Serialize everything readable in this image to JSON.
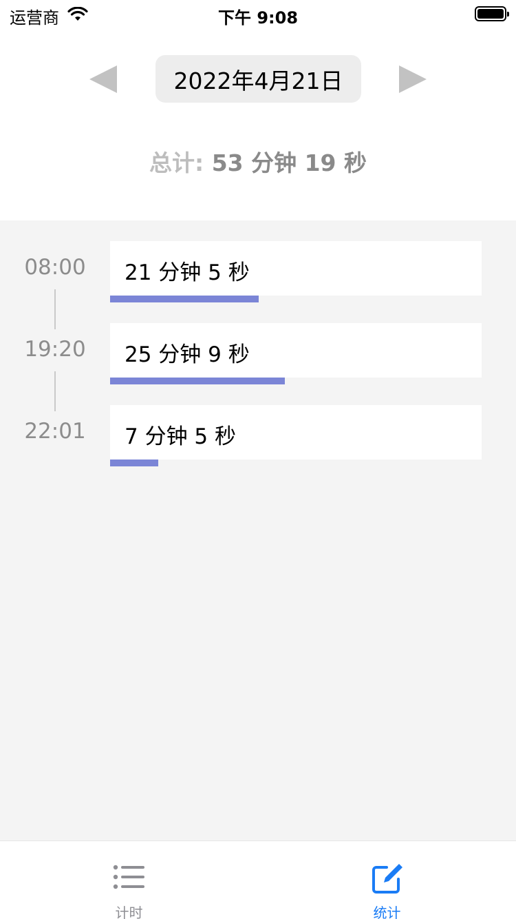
{
  "status_bar": {
    "carrier": "运营商",
    "time": "下午 9:08",
    "wifi_icon": "wifi-icon",
    "battery_icon": "battery-icon"
  },
  "date_nav": {
    "date": "2022年4月21日",
    "prev_icon": "triangle-left-icon",
    "next_icon": "triangle-right-icon"
  },
  "summary": {
    "label": "总计:",
    "value": "53 分钟 19 秒"
  },
  "entries": [
    {
      "time": "08:00",
      "duration": "21 分钟 5 秒",
      "progress": 0.4
    },
    {
      "time": "19:20",
      "duration": "25 分钟 9 秒",
      "progress": 0.47
    },
    {
      "time": "22:01",
      "duration": "7 分钟 5 秒",
      "progress": 0.13
    }
  ],
  "tab_bar": {
    "tabs": [
      {
        "label": "计时",
        "icon": "list-icon",
        "active": false
      },
      {
        "label": "统计",
        "icon": "edit-icon",
        "active": true
      }
    ]
  },
  "colors": {
    "accent": "#1a7cf5",
    "progress": "#7b85d6",
    "content_bg": "#f4f4f4",
    "muted_text": "#8c8c8c"
  }
}
